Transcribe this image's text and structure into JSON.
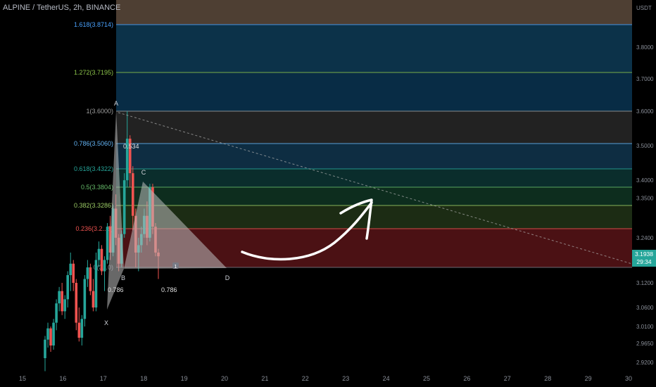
{
  "header": {
    "title": "ALPINE / TetherUS, 2h, BINANCE"
  },
  "chart_data": {
    "type": "candlestick",
    "title": "ALPINE / TetherUS, 2h, BINANCE",
    "symbol": "ALPINE / TetherUS",
    "interval": "2h",
    "exchange": "BINANCE",
    "axis_unit": "USDT",
    "x_ticks": [
      "15",
      "16",
      "17",
      "18",
      "19",
      "20",
      "21",
      "22",
      "23",
      "24",
      "25",
      "26",
      "27",
      "28",
      "29",
      "30"
    ],
    "y_ticks": [
      "3.8000",
      "3.7000",
      "3.6000",
      "3.5000",
      "3.4000",
      "3.3500",
      "3.2400",
      "3.1200",
      "3.0600",
      "3.0100",
      "2.9650",
      "2.9200"
    ],
    "current_price": "3.1938",
    "countdown": "29:34",
    "colors": {
      "up": "#26a69a",
      "down": "#ef5350"
    },
    "fib_levels": [
      {
        "label": "1.618(3.8714)",
        "ratio": 1.618,
        "price": 3.8714,
        "color": "#4aa3ff"
      },
      {
        "label": "1.272(3.7195)",
        "ratio": 1.272,
        "price": 3.7195,
        "color": "#8bc34a"
      },
      {
        "label": "1(3.6000)",
        "ratio": 1,
        "price": 3.6,
        "color": "#9e9e9e"
      },
      {
        "label": "0.786(3.5060)",
        "ratio": 0.786,
        "price": 3.506,
        "color": "#64b5f6"
      },
      {
        "label": "0.618(3.4322)",
        "ratio": 0.618,
        "price": 3.4322,
        "color": "#26a69a"
      },
      {
        "label": "0.5(3.3804)",
        "ratio": 0.5,
        "price": 3.3804,
        "color": "#66bb6a"
      },
      {
        "label": "0.382(3.3286)",
        "ratio": 0.382,
        "price": 3.3286,
        "color": "#9ccc65"
      },
      {
        "label": "0.236(3.2...5)",
        "ratio": 0.236,
        "price": 3.2645,
        "color": "#ef5350"
      },
      {
        "label": "0(3...0)",
        "ratio": 0,
        "price": 3.16,
        "color": "#787b86"
      }
    ],
    "pattern_points": [
      {
        "label": "X"
      },
      {
        "label": "A"
      },
      {
        "label": "B"
      },
      {
        "label": "C"
      },
      {
        "label": "D"
      }
    ],
    "pattern_ratios": [
      "0.534",
      "0.786",
      "0.786"
    ],
    "candles": [
      {
        "o": 2.93,
        "h": 2.985,
        "l": 2.9,
        "c": 2.975
      },
      {
        "o": 2.975,
        "h": 3.02,
        "l": 2.955,
        "c": 3.005
      },
      {
        "o": 3.005,
        "h": 3.01,
        "l": 2.945,
        "c": 2.96
      },
      {
        "o": 2.96,
        "h": 3.03,
        "l": 2.95,
        "c": 3.02
      },
      {
        "o": 3.02,
        "h": 3.08,
        "l": 3.0,
        "c": 3.07
      },
      {
        "o": 3.07,
        "h": 3.11,
        "l": 3.05,
        "c": 3.1
      },
      {
        "o": 3.1,
        "h": 3.12,
        "l": 3.04,
        "c": 3.05
      },
      {
        "o": 3.05,
        "h": 3.09,
        "l": 3.03,
        "c": 3.08
      },
      {
        "o": 3.08,
        "h": 3.15,
        "l": 3.06,
        "c": 3.14
      },
      {
        "o": 3.14,
        "h": 3.2,
        "l": 3.1,
        "c": 3.17
      },
      {
        "o": 3.17,
        "h": 3.18,
        "l": 3.1,
        "c": 3.12
      },
      {
        "o": 3.12,
        "h": 3.13,
        "l": 3.0,
        "c": 3.02
      },
      {
        "o": 3.02,
        "h": 3.06,
        "l": 2.97,
        "c": 2.98
      },
      {
        "o": 2.98,
        "h": 3.04,
        "l": 2.96,
        "c": 3.03
      },
      {
        "o": 3.03,
        "h": 3.14,
        "l": 3.01,
        "c": 3.13
      },
      {
        "o": 3.13,
        "h": 3.18,
        "l": 3.11,
        "c": 3.16
      },
      {
        "o": 3.16,
        "h": 3.17,
        "l": 3.09,
        "c": 3.1
      },
      {
        "o": 3.1,
        "h": 3.13,
        "l": 3.05,
        "c": 3.06
      },
      {
        "o": 3.06,
        "h": 3.2,
        "l": 3.05,
        "c": 3.18
      },
      {
        "o": 3.18,
        "h": 3.23,
        "l": 3.16,
        "c": 3.21
      },
      {
        "o": 3.21,
        "h": 3.22,
        "l": 3.14,
        "c": 3.15
      },
      {
        "o": 3.15,
        "h": 3.19,
        "l": 3.1,
        "c": 3.18
      },
      {
        "o": 3.18,
        "h": 3.28,
        "l": 3.17,
        "c": 3.27
      },
      {
        "o": 3.27,
        "h": 3.3,
        "l": 3.18,
        "c": 3.2
      },
      {
        "o": 3.2,
        "h": 3.33,
        "l": 3.19,
        "c": 3.32
      },
      {
        "o": 3.32,
        "h": 3.36,
        "l": 3.22,
        "c": 3.24
      },
      {
        "o": 3.24,
        "h": 3.25,
        "l": 3.15,
        "c": 3.17
      },
      {
        "o": 3.17,
        "h": 3.26,
        "l": 3.16,
        "c": 3.25
      },
      {
        "o": 3.25,
        "h": 3.42,
        "l": 3.24,
        "c": 3.4
      },
      {
        "o": 3.4,
        "h": 3.6,
        "l": 3.38,
        "c": 3.52
      },
      {
        "o": 3.52,
        "h": 3.53,
        "l": 3.38,
        "c": 3.42
      },
      {
        "o": 3.42,
        "h": 3.44,
        "l": 3.26,
        "c": 3.3
      },
      {
        "o": 3.3,
        "h": 3.32,
        "l": 3.16,
        "c": 3.2
      },
      {
        "o": 3.2,
        "h": 3.24,
        "l": 3.15,
        "c": 3.22
      },
      {
        "o": 3.22,
        "h": 3.27,
        "l": 3.2,
        "c": 3.25
      },
      {
        "o": 3.25,
        "h": 3.32,
        "l": 3.24,
        "c": 3.3
      },
      {
        "o": 3.3,
        "h": 3.34,
        "l": 3.22,
        "c": 3.24
      },
      {
        "o": 3.24,
        "h": 3.39,
        "l": 3.23,
        "c": 3.38
      },
      {
        "o": 3.38,
        "h": 3.39,
        "l": 3.25,
        "c": 3.27
      },
      {
        "o": 3.27,
        "h": 3.28,
        "l": 3.19,
        "c": 3.2
      },
      {
        "o": 3.2,
        "h": 3.21,
        "l": 3.13,
        "c": 3.19
      }
    ]
  }
}
